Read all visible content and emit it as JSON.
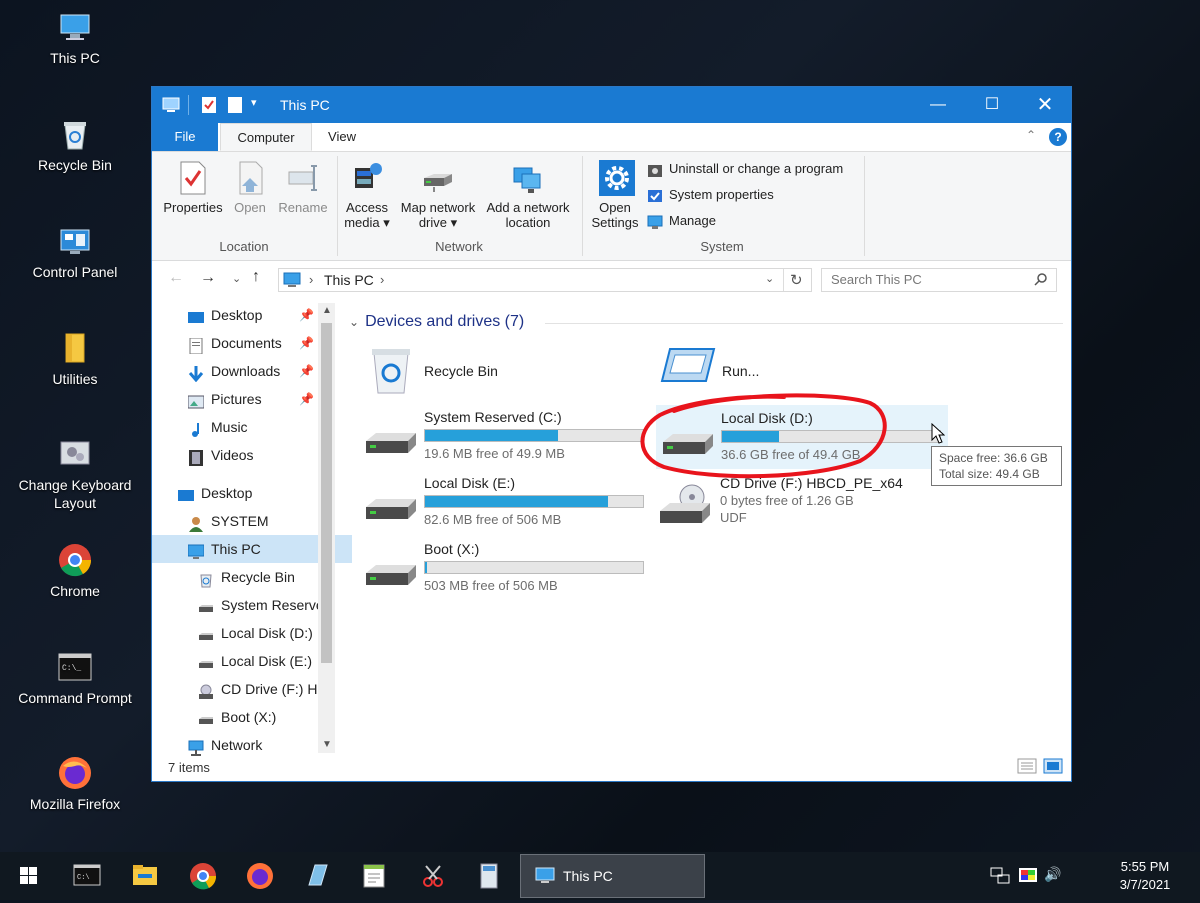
{
  "desktop": {
    "icons": [
      {
        "label": "This PC",
        "icon": "this-pc-icon"
      },
      {
        "label": "Recycle Bin",
        "icon": "recycle-bin-icon"
      },
      {
        "label": "Control Panel",
        "icon": "control-panel-icon"
      },
      {
        "label": "Utilities",
        "icon": "folder-icon"
      },
      {
        "label": "Change Keyboard Layout",
        "icon": "keyboard-layout-icon"
      },
      {
        "label": "Chrome",
        "icon": "chrome-icon"
      },
      {
        "label": "Command Prompt",
        "icon": "command-prompt-icon"
      },
      {
        "label": "Mozilla Firefox",
        "icon": "firefox-icon"
      }
    ]
  },
  "window": {
    "title": "This PC",
    "tabs": {
      "file": "File",
      "computer": "Computer",
      "view": "View"
    },
    "ribbon": {
      "location": {
        "group": "Location",
        "properties": "Properties",
        "open": "Open",
        "rename": "Rename"
      },
      "network": {
        "group": "Network",
        "access_media_1": "Access",
        "access_media_2": "media ▾",
        "map_drive_1": "Map network",
        "map_drive_2": "drive ▾",
        "add_location_1": "Add a network",
        "add_location_2": "location"
      },
      "system": {
        "group": "System",
        "open_settings_1": "Open",
        "open_settings_2": "Settings",
        "uninstall": "Uninstall or change a program",
        "sysprops": "System properties",
        "manage": "Manage"
      }
    },
    "address": {
      "crumb": "This PC",
      "search_placeholder": "Search This PC"
    },
    "nav": [
      {
        "label": "Desktop",
        "pinned": true
      },
      {
        "label": "Documents",
        "pinned": true
      },
      {
        "label": "Downloads",
        "pinned": true
      },
      {
        "label": "Pictures",
        "pinned": true
      },
      {
        "label": "Music",
        "pinned": false
      },
      {
        "label": "Videos",
        "pinned": false
      },
      {
        "label": "Desktop",
        "pinned": false
      },
      {
        "label": "SYSTEM",
        "pinned": false
      },
      {
        "label": "This PC",
        "pinned": false
      },
      {
        "label": "Recycle Bin",
        "pinned": false
      },
      {
        "label": "System Reserve",
        "pinned": false
      },
      {
        "label": "Local Disk (D:)",
        "pinned": false
      },
      {
        "label": "Local Disk (E:)",
        "pinned": false
      },
      {
        "label": "CD Drive (F:) H",
        "pinned": false
      },
      {
        "label": "Boot (X:)",
        "pinned": false
      },
      {
        "label": "Network",
        "pinned": false
      }
    ],
    "section_title": "Devices and drives (7)",
    "items": {
      "recycle": "Recycle Bin",
      "run": "Run...",
      "c": {
        "name": "System Reserved (C:)",
        "free": "19.6 MB free of 49.9 MB",
        "used_fraction": 0.61
      },
      "d": {
        "name": "Local Disk (D:)",
        "free": "36.6 GB free of 49.4 GB",
        "used_fraction": 0.26
      },
      "e": {
        "name": "Local Disk (E:)",
        "free": "82.6 MB free of 506 MB",
        "used_fraction": 0.84
      },
      "f": {
        "name": "CD Drive (F:) HBCD_PE_x64",
        "free": "0 bytes free of 1.26 GB",
        "fs": "UDF"
      },
      "x": {
        "name": "Boot (X:)",
        "free": "503 MB free of 506 MB",
        "used_fraction": 0.01
      }
    },
    "tooltip": {
      "line1": "Space free: 36.6 GB",
      "line2": "Total size: 49.4 GB"
    },
    "status": "7 items"
  },
  "taskbar": {
    "active_label": "This PC",
    "time": "5:55 PM",
    "date": "3/7/2021"
  },
  "colors": {
    "accent": "#1a7ad2",
    "bar_fill": "#26a0da",
    "annotation": "#e8141c"
  }
}
